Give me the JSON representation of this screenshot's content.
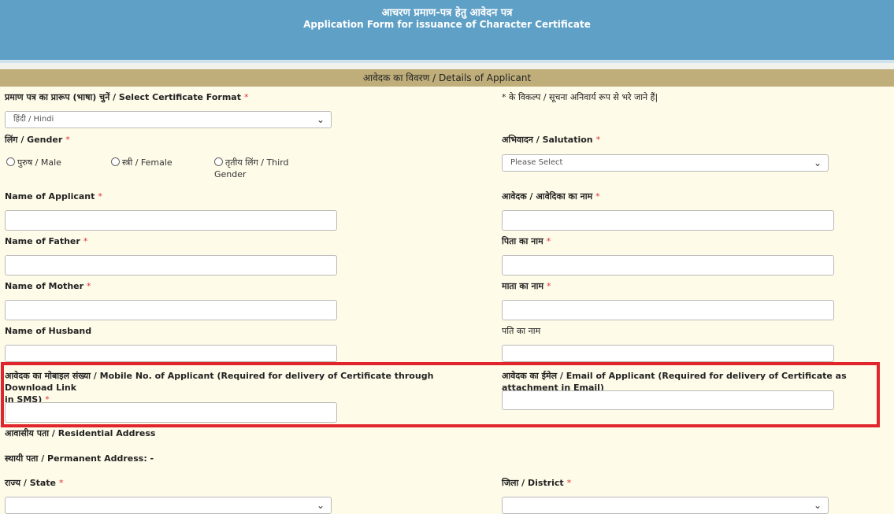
{
  "header": {
    "title_hi": "आचरण प्रमाण-पत्र हेतु आवेदन पत्र",
    "title_en": "Application Form for issuance of Character Certificate"
  },
  "section": {
    "title": "आवेदक का विवरण / Details of Applicant"
  },
  "required_marker": "*",
  "certificate_format": {
    "label": "प्रमाण पत्र का प्रारूप (भाषा) चुनें / Select Certificate Format",
    "selected": "हिंदी / Hindi"
  },
  "mandatory_note": "* के विकल्प / सूचना अनिवार्य रूप से भरे जाने हैं|",
  "gender": {
    "label": "लिंग / Gender",
    "options": [
      "पुरुष / Male",
      "स्त्री / Female",
      "तृतीय लिंग / Third",
      "Gender"
    ]
  },
  "salutation": {
    "label": "अभिवादन / Salutation",
    "placeholder": "Please Select"
  },
  "fields": {
    "name_applicant_en": "Name of Applicant",
    "name_applicant_hi": "आवेदक / आवेदिका का नाम",
    "father_en": "Name of Father",
    "father_hi": "पिता का नाम",
    "mother_en": "Name of Mother",
    "mother_hi": "माता का नाम",
    "husband_en": "Name of Husband",
    "husband_hi": "पति का नाम",
    "mobile_line1": "आवेदक का मोबाइल संख्या / Mobile No. of Applicant (Required for delivery of Certificate through Download Link",
    "mobile_line2": "in SMS)",
    "email": "आवेदक का ईमेल / Email of Applicant (Required for delivery of Certificate as attachment in Email)"
  },
  "address": {
    "residential": "आवासीय पता / Residential Address",
    "permanent": "स्थायी पता / Permanent Address: -"
  },
  "state": {
    "label": "राज्य / State"
  },
  "district": {
    "label": "जिला / District"
  }
}
